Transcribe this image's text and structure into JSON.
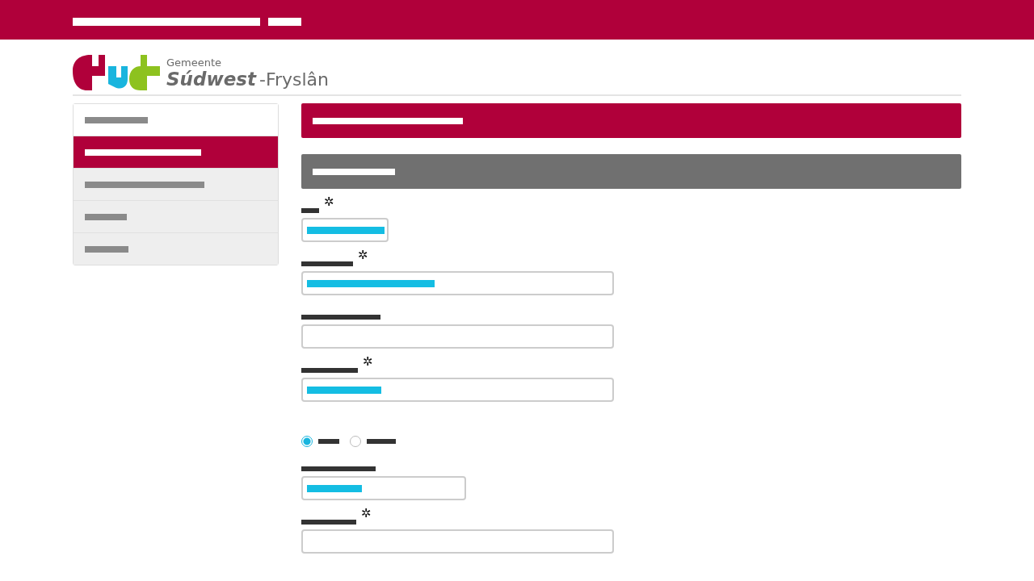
{
  "logo": {
    "line_1": "Gemeente",
    "name_bold": "Súdwest",
    "name_rest": "-Fryslân"
  },
  "sidebar": {
    "items": [
      {
        "selected": false
      },
      {
        "selected": true
      },
      {
        "selected": false
      },
      {
        "selected": false
      },
      {
        "selected": false
      }
    ]
  },
  "form": {
    "fields": [
      {
        "required_mark": "✲",
        "filled": true
      },
      {
        "required_mark": "✲",
        "filled": true
      },
      {
        "filled": false
      },
      {
        "required_mark": "✲",
        "filled": true
      },
      {
        "kind": "radios",
        "options": [
          {
            "selected": true
          },
          {
            "selected": false
          }
        ]
      },
      {
        "filled": true
      },
      {
        "required_mark": "✲",
        "filled": false
      }
    ]
  }
}
